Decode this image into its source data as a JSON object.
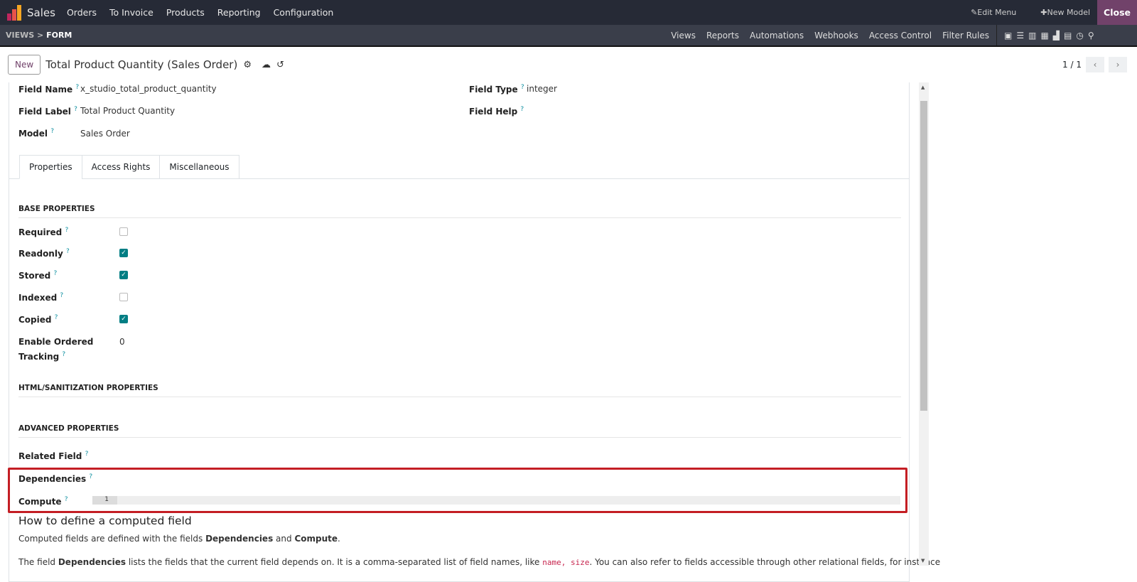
{
  "topnav": {
    "app": "Sales",
    "menus": [
      "Orders",
      "To Invoice",
      "Products",
      "Reporting",
      "Configuration"
    ],
    "edit_menu": "Edit Menu",
    "new_model": "New Model",
    "close": "Close"
  },
  "subnav": {
    "crumb_parent": "VIEWS",
    "crumb_sep": ">",
    "crumb_current": "FORM",
    "links": [
      "Views",
      "Reports",
      "Automations",
      "Webhooks",
      "Access Control",
      "Filter Rules"
    ]
  },
  "control": {
    "new_label": "New",
    "title": "Total Product Quantity (Sales Order)",
    "pager": "1 / 1"
  },
  "fields": {
    "field_name_label": "Field Name",
    "field_name": "x_studio_total_product_quantity",
    "field_label_label": "Field Label",
    "field_label": "Total Product Quantity",
    "model_label": "Model",
    "model": "Sales Order",
    "field_type_label": "Field Type",
    "field_type": "integer",
    "field_help_label": "Field Help",
    "help_mark": "?"
  },
  "tabs": [
    "Properties",
    "Access Rights",
    "Miscellaneous"
  ],
  "base": {
    "title": "BASE PROPERTIES",
    "required": "Required",
    "readonly": "Readonly",
    "stored": "Stored",
    "indexed": "Indexed",
    "copied": "Copied",
    "tracking_1": "Enable Ordered",
    "tracking_2": "Tracking",
    "tracking_value": "0",
    "checks": {
      "required": false,
      "readonly": true,
      "stored": true,
      "indexed": false,
      "copied": true
    }
  },
  "html_title": "HTML/SANITIZATION PROPERTIES",
  "advanced": {
    "title": "ADVANCED PROPERTIES",
    "related": "Related Field",
    "dependencies": "Dependencies",
    "compute": "Compute",
    "line_no": "1"
  },
  "help": {
    "heading": "How to define a computed field",
    "p1_a": "Computed fields are defined with the fields ",
    "p1_b": "Dependencies",
    "p1_c": " and ",
    "p1_d": "Compute",
    "p1_e": ".",
    "p2_a": "The field ",
    "p2_b": "Dependencies",
    "p2_c": " lists the fields that the current field depends on. It is a comma-separated list of field names, like ",
    "p2_code": "name, size",
    "p2_d": ". You can also refer to fields accessible through other relational fields, for instance"
  }
}
